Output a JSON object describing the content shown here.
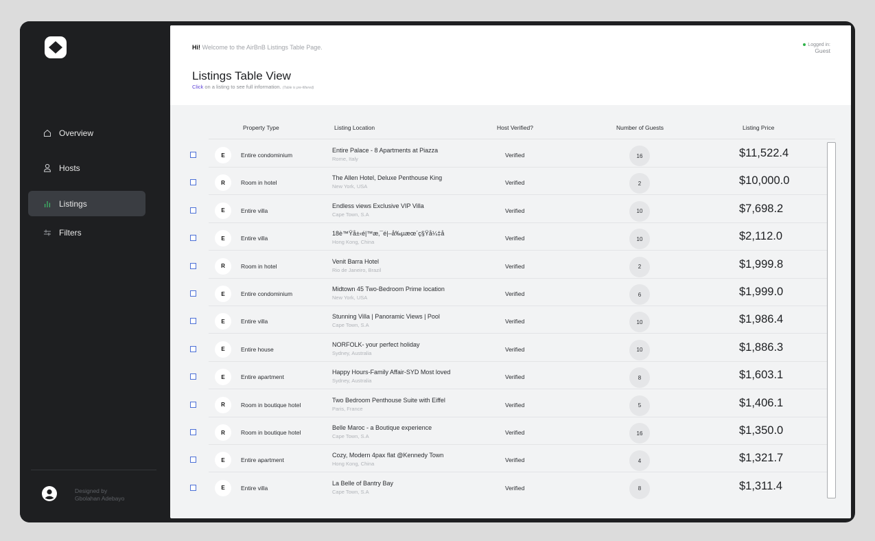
{
  "sidebar": {
    "nav": [
      {
        "label": "Overview",
        "icon": "home-icon"
      },
      {
        "label": "Hosts",
        "icon": "user-icon"
      },
      {
        "label": "Listings",
        "icon": "bar-chart-icon",
        "active": true
      },
      {
        "label": "Filters",
        "icon": "filter-icon"
      }
    ],
    "footer": {
      "line1": "Designed by",
      "line2": "Gbolahan Adebayo"
    }
  },
  "header": {
    "greeting_bold": "Hi!",
    "greeting_rest": " Welcome to the AirBnB Listings Table Page.",
    "login_label": "Logged in:",
    "login_user": "Guest",
    "title": "Listings Table View",
    "subtitle_click": "Click",
    "subtitle_rest": " on a listing to see full information.",
    "subtitle_note": "(Table is pre-filtered)"
  },
  "table": {
    "columns": [
      "Property Type",
      "Listing Location",
      "Host Verified?",
      "Number of Guests",
      "Listing Price"
    ],
    "rows": [
      {
        "initial": "E",
        "type": "Entire condominium",
        "name": "Entire Palace - 8 Apartments at Piazza",
        "city": "Rome, Italy",
        "verified": "Verified",
        "guests": "16",
        "price": "$11,522.4"
      },
      {
        "initial": "R",
        "type": "Room in hotel",
        "name": "The Allen Hotel, Deluxe Penthouse King",
        "city": "New York, USA",
        "verified": "Verified",
        "guests": "2",
        "price": "$10,000.0"
      },
      {
        "initial": "E",
        "type": "Entire villa",
        "name": "Endless views Exclusive VIP Villa",
        "city": "Cape Town, S.A",
        "verified": "Verified",
        "guests": "10",
        "price": "$7,698.2"
      },
      {
        "initial": "E",
        "type": "Entire villa",
        "name": "18è™Ÿå±‹é|™æ‚¯é|–å‰µæœ´ç§Ÿå¼‡å",
        "city": "Hong Kong, China",
        "verified": "Verified",
        "guests": "10",
        "price": "$2,112.0"
      },
      {
        "initial": "R",
        "type": "Room in hotel",
        "name": "Venit Barra Hotel",
        "city": "Rio de Janeiro, Brazil",
        "verified": "Verified",
        "guests": "2",
        "price": "$1,999.8"
      },
      {
        "initial": "E",
        "type": "Entire condominium",
        "name": "Midtown 45 Two-Bedroom Prime location",
        "city": "New York, USA",
        "verified": "Verified",
        "guests": "6",
        "price": "$1,999.0"
      },
      {
        "initial": "E",
        "type": "Entire villa",
        "name": "Stunning Villa | Panoramic Views | Pool",
        "city": "Cape Town, S.A",
        "verified": "Verified",
        "guests": "10",
        "price": "$1,986.4"
      },
      {
        "initial": "E",
        "type": "Entire house",
        "name": "NORFOLK- your perfect holiday",
        "city": "Sydney, Australia",
        "verified": "Verified",
        "guests": "10",
        "price": "$1,886.3"
      },
      {
        "initial": "E",
        "type": "Entire apartment",
        "name": "Happy Hours-Family Affair-SYD Most loved",
        "city": "Sydney, Australia",
        "verified": "Verified",
        "guests": "8",
        "price": "$1,603.1"
      },
      {
        "initial": "R",
        "type": "Room in boutique hotel",
        "name": "Two Bedroom Penthouse Suite with Eiffel",
        "city": "Paris, France",
        "verified": "Verified",
        "guests": "5",
        "price": "$1,406.1"
      },
      {
        "initial": "R",
        "type": "Room in boutique hotel",
        "name": "Belle Maroc - a Boutique experience",
        "city": "Cape Town, S.A",
        "verified": "Verified",
        "guests": "16",
        "price": "$1,350.0"
      },
      {
        "initial": "E",
        "type": "Entire apartment",
        "name": "Cozy, Modern 4pax flat @Kennedy Town",
        "city": "Hong Kong, China",
        "verified": "Verified",
        "guests": "4",
        "price": "$1,321.7"
      },
      {
        "initial": "E",
        "type": "Entire villa",
        "name": "La Belle of Bantry Bay",
        "city": "Cape Town, S.A",
        "verified": "Verified",
        "guests": "8",
        "price": "$1,311.4"
      }
    ]
  },
  "colors": {
    "sidebar": "#1e1f21",
    "active_nav": "#3a3d42",
    "accent": "#5b3fd6",
    "online": "#2fb34a"
  }
}
